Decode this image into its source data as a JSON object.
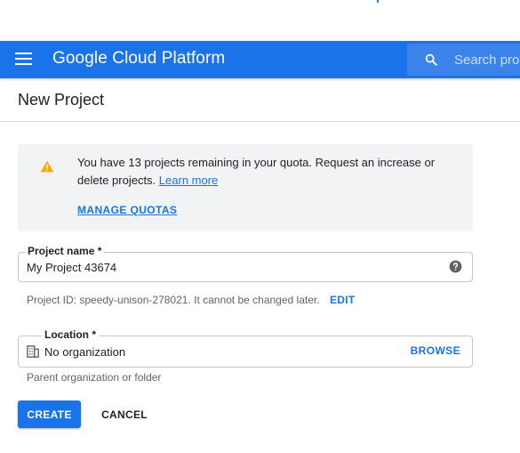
{
  "header": {
    "brand": "Google Cloud Platform",
    "search_placeholder": "Search products"
  },
  "page": {
    "title": "New Project"
  },
  "notice": {
    "text": "You have 13 projects remaining in your quota. Request an increase or delete projects.",
    "learn_more": "Learn more",
    "manage_quotas": "MANAGE QUOTAS"
  },
  "project_name": {
    "label": "Project name *",
    "value": "My Project 43674"
  },
  "project_id": {
    "hint": "Project ID: speedy-unison-278021. It cannot be changed later.",
    "edit": "EDIT"
  },
  "location": {
    "label": "Location *",
    "value": "No organization",
    "browse": "BROWSE",
    "hint": "Parent organization or folder"
  },
  "actions": {
    "create": "CREATE",
    "cancel": "CANCEL"
  },
  "icons": {
    "menu": "hamburger-menu-icon",
    "search": "search-icon",
    "warning": "warning-icon",
    "help": "help-icon",
    "organization": "organization-icon"
  },
  "colors": {
    "brand_blue": "#1a73e8",
    "warning": "#f9ab00",
    "notice_bg": "#f1f3f4"
  }
}
